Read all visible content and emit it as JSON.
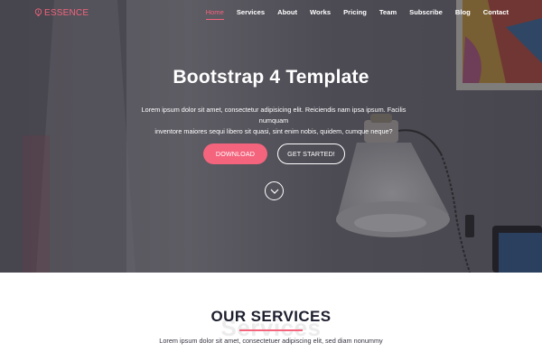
{
  "brand": {
    "name": "ESSENCE",
    "icon": "bulb-icon",
    "color": "#f4647d"
  },
  "nav": {
    "items": [
      "Home",
      "Services",
      "About",
      "Works",
      "Pricing",
      "Team",
      "Subscribe",
      "Blog",
      "Contact"
    ],
    "active": "Home"
  },
  "hero": {
    "title": "Bootstrap 4 Template",
    "text_line1": "Lorem ipsum dolor sit amet, consectetur adipisicing elit. Reiciendis nam ipsa ipsum. Facilis numquam",
    "text_line2": "inventore maiores sequi libero sit quasi, sint enim nobis, quidem, cumque neque?",
    "download_label": "DOWNLOAD",
    "get_started_label": "GET STARTED!",
    "scroll_icon": "chevron-down-icon"
  },
  "services": {
    "title": "OUR SERVICES",
    "ghost_text": "Services",
    "subtitle": "Lorem ipsum dolor sit amet, consectetuer adipiscing elit, sed diam nonummy"
  },
  "colors": {
    "accent": "#f4647d",
    "heading": "#1d1f2e",
    "white": "#ffffff"
  }
}
